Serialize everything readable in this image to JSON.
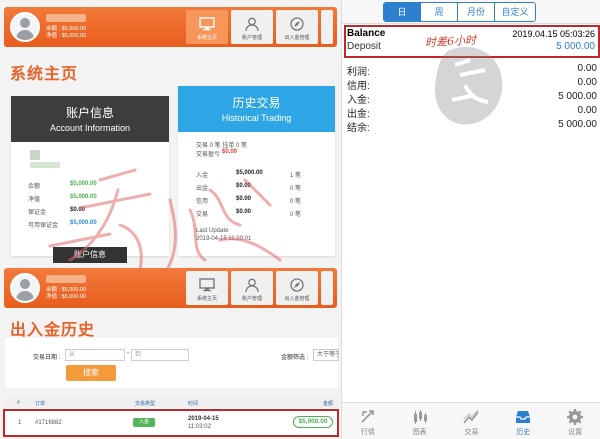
{
  "left": {
    "account_top": {
      "balance": "余额 : $5,000.00",
      "equity": "净值 : $5,000.00",
      "nav": [
        "系统主页",
        "账户管理",
        "出入金管理"
      ]
    },
    "section1_title": "系统主页",
    "account_card": {
      "title_cn": "账户信息",
      "title_en": "Account Information",
      "rows": [
        {
          "label": "余额",
          "value": "$5,000.00"
        },
        {
          "label": "净值",
          "value": "$5,000.00"
        },
        {
          "label": "保证金",
          "value": "$0.00"
        },
        {
          "label": "可用保证金",
          "value": "$5,000.00"
        }
      ],
      "button": "账户信息"
    },
    "history_card": {
      "title_cn": "历史交易",
      "title_en": "Historical Trading",
      "line1": "交易 0 笔   挂单 0 笔",
      "line2_label": "交易盈亏",
      "line2_value": "$0.00",
      "rows": [
        {
          "label": "入金",
          "value": "$5,000.00",
          "note": "1 笔"
        },
        {
          "label": "出金",
          "value": "$0.00",
          "note": "0 笔"
        },
        {
          "label": "信用",
          "value": "$0.00",
          "note": "0 笔"
        },
        {
          "label": "交易",
          "value": "$0.00",
          "note": "0 笔"
        }
      ],
      "last_update_label": "Last Update",
      "last_update": "2019-04-15 11:20:01"
    },
    "account_bottom": {
      "balance": "余额 : $5,000.00",
      "equity": "净值 : $5,000.00",
      "nav": [
        "系统主页",
        "账户管理",
        "出入金管理"
      ]
    },
    "section2_title": "出入金历史",
    "filter": {
      "date_label": "交易日期 :",
      "from_placeholder": "从",
      "to_placeholder": "到",
      "dash": "-",
      "amount_label": "金额筛选 :",
      "amount_value": "大于等于",
      "search_button": "搜索"
    },
    "table": {
      "headers": [
        "#",
        "订单",
        "交易类型",
        "时间",
        "金额"
      ],
      "row": {
        "index": "1",
        "order": "#1716882",
        "type": "入金",
        "date": "2019-04-15",
        "time": "11:03:02",
        "amount": "$5,000.00"
      }
    }
  },
  "right": {
    "segments": [
      "日",
      "周",
      "月份",
      "自定义"
    ],
    "active_segment": 0,
    "balance_label": "Balance",
    "balance_date": "2019.04.15 05:03:26",
    "deposit_label": "Deposit",
    "deposit_amount": "5 000.00",
    "annotation": "时差6小时",
    "stats": [
      {
        "label": "利润:",
        "value": "0.00"
      },
      {
        "label": "信用:",
        "value": "0.00"
      },
      {
        "label": "入金:",
        "value": "5 000.00"
      },
      {
        "label": "出金:",
        "value": "0.00"
      },
      {
        "label": "结余:",
        "value": "5 000.00"
      }
    ],
    "tabs": [
      {
        "label": "行情",
        "icon": "quotes-icon"
      },
      {
        "label": "图表",
        "icon": "chart-icon"
      },
      {
        "label": "交易",
        "icon": "trade-icon"
      },
      {
        "label": "历史",
        "icon": "history-icon"
      },
      {
        "label": "设置",
        "icon": "settings-icon"
      }
    ],
    "active_tab": 3
  },
  "colors": {
    "orange": "#e8632a",
    "blue": "#2f7fd1",
    "red_frame": "#c0272d",
    "green": "#4caf50"
  }
}
